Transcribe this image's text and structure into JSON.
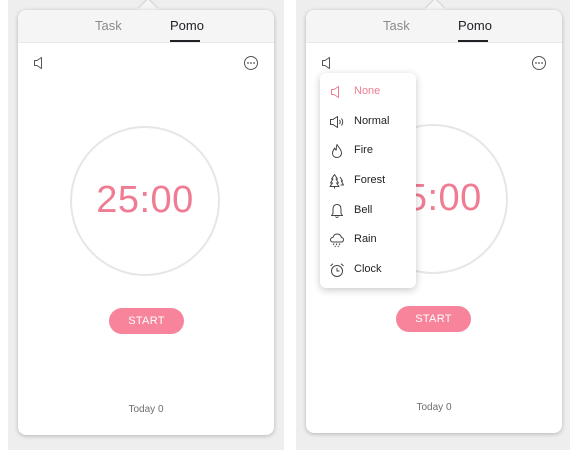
{
  "tabs": {
    "task_label": "Task",
    "pomo_label": "Pomo",
    "active": "Pomo"
  },
  "timer": {
    "display": "25:00",
    "start_label": "START",
    "today_label": "Today 0"
  },
  "sound_menu": {
    "selected": "None",
    "items": [
      {
        "label": "None",
        "icon": "speaker-muted-icon"
      },
      {
        "label": "Normal",
        "icon": "speaker-icon"
      },
      {
        "label": "Fire",
        "icon": "fire-icon"
      },
      {
        "label": "Forest",
        "icon": "forest-icon"
      },
      {
        "label": "Bell",
        "icon": "bell-icon"
      },
      {
        "label": "Rain",
        "icon": "rain-icon"
      },
      {
        "label": "Clock",
        "icon": "alarm-clock-icon"
      }
    ]
  },
  "colors": {
    "accent": "#f07c93",
    "button": "#f7849b",
    "ring": "#e6e6e8"
  }
}
